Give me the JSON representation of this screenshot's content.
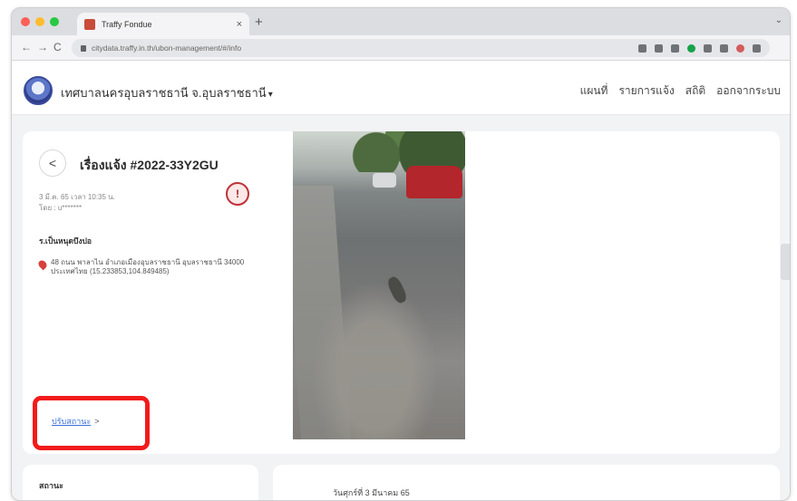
{
  "browser": {
    "tab_title": "Traffy Fondue",
    "tab_close": "×",
    "new_tab": "+",
    "url": "citydata.traffy.in.th/ubon-management/#/info",
    "nav_back": "←",
    "nav_forward": "→",
    "nav_reload": "C",
    "tab_menu": "⌄"
  },
  "header": {
    "site_name": "เทศบาลนครอุบลราชธานี จ.อุบลราชธานี",
    "site_caret": "▾",
    "nav": [
      "แผนที่",
      "รายการแจ้ง",
      "สถิติ",
      "ออกจากระบบ"
    ]
  },
  "issue": {
    "back_label": "<",
    "title": "เรื่องแจ้ง #2022-33Y2GU",
    "date": "3 มี.ค. 65 เวลา 10:35 น.",
    "reporter": "โดย : u*******",
    "alert_icon": "!",
    "agency": "ร.เป็นหนุดบึงปอ",
    "address": "48 ถนน พาลาไน อำเภอเมืองอุบลราชธานี อุบลราชธานี 34000 ประเทศไทย (15.233853,104.849485)",
    "status_link": "ปรับสถานะ",
    "status_chevron": ">"
  },
  "bottom": {
    "left_label": "สถานะ",
    "date_line": "วันศุกร์ที่ 3 มีนาคม 65"
  },
  "colors": {
    "highlight": "#f21b1b",
    "link": "#3a6fd8",
    "alert": "#c0313a"
  },
  "icons": [
    "lock-icon",
    "pin-icon",
    "alert-icon",
    "back-icon",
    "chevron-right-icon"
  ]
}
